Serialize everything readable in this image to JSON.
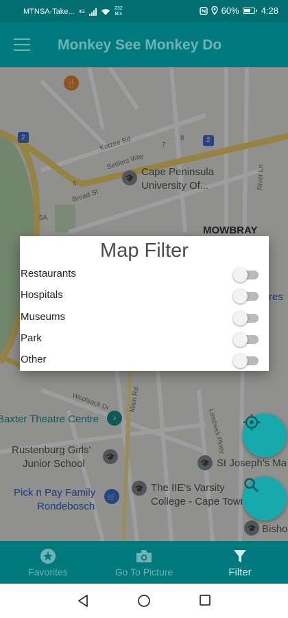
{
  "status_bar": {
    "carrier": "MTNSA-Take...",
    "network": "4G",
    "net_speed_value": "232",
    "net_speed_unit": "B/s",
    "battery": "60%",
    "time": "4:28"
  },
  "app_bar": {
    "title": "Monkey See Monkey Do"
  },
  "map": {
    "labels": {
      "university_line1": "Cape Peninsula",
      "university_line2": "University Of...",
      "mowbray": "MOWBRAY",
      "baxter": "Baxter Theatre Centre",
      "rustenburg_line1": "Rustenburg Girls'",
      "rustenburg_line2": "Junior School",
      "picknpay_line1": "Pick n Pay Family",
      "picknpay_line2": "Rondebosch",
      "iie_line1": "The IIE's Varsity",
      "iie_line2": "College - Cape Town",
      "st_josephs": "St Joseph's Ma",
      "bisho": "Bisho",
      "res": "res",
      "settlers_way": "Settlers Way",
      "kotzee_rd": "Kotzee Rd",
      "broad_st": "Broad St",
      "woolsack_dr": "Woolsack Dr",
      "main_rd": "Main Rd",
      "liesbeek_pkwy": "Liesbeek Pkwy",
      "river_ln": "River Ln",
      "road_2a": "2",
      "road_2b": "2",
      "road_5a": "5A",
      "road_6": "6",
      "road_7": "7",
      "road_8": "8"
    }
  },
  "filter_dialog": {
    "title": "Map Filter",
    "options": [
      {
        "label": "Restaurants",
        "enabled": false
      },
      {
        "label": "Hospitals",
        "enabled": false
      },
      {
        "label": "Museums",
        "enabled": false
      },
      {
        "label": "Park",
        "enabled": false
      },
      {
        "label": "Other",
        "enabled": false
      }
    ]
  },
  "fabs": {
    "locate_icon": "crosshair-icon",
    "search_icon": "search-icon"
  },
  "bottom_nav": {
    "items": [
      {
        "label": "Favorites",
        "icon": "star-icon",
        "active": false
      },
      {
        "label": "Go To Picture",
        "icon": "camera-icon",
        "active": false
      },
      {
        "label": "Filter",
        "icon": "filter-icon",
        "active": true
      }
    ]
  },
  "colors": {
    "primary": "#007a7c",
    "fab": "#17aaac"
  }
}
